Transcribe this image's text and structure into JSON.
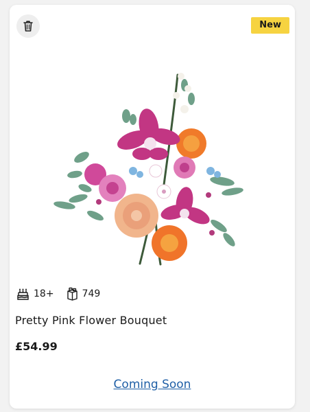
{
  "product": {
    "badge": "New",
    "age": "18+",
    "pieces": "749",
    "title": "Pretty Pink Flower Bouquet",
    "price": "£54.99",
    "cta_label": "Coming Soon",
    "image_alt": "Pretty Pink Flower Bouquet"
  },
  "icons": {
    "wishlist": "bin-icon",
    "age": "birthday-cake-icon",
    "pieces": "brick-icon"
  },
  "colors": {
    "badge": "#f6d341",
    "link": "#1f5fa6",
    "text": "#1a1a1a"
  }
}
